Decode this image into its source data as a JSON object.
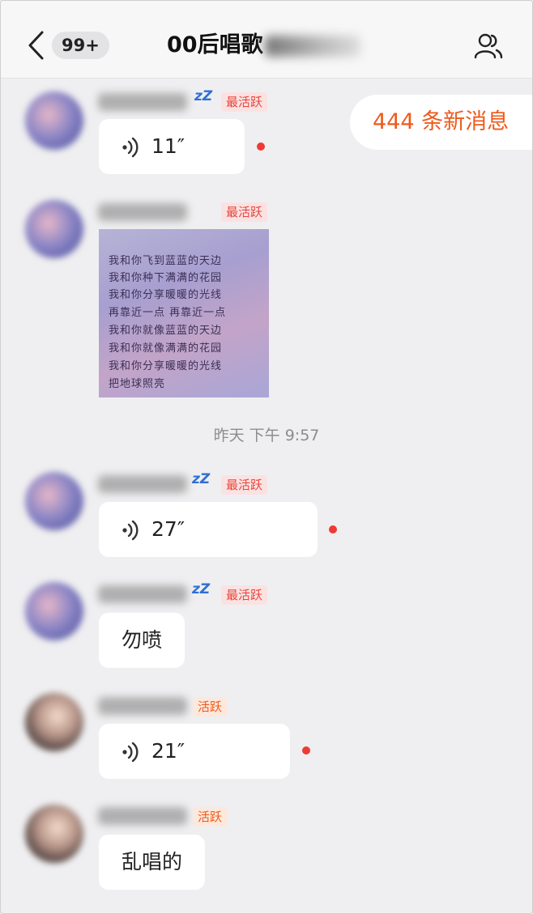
{
  "header": {
    "unread_count": "99+",
    "title": "00后唱歌"
  },
  "icons": {
    "back": "chevron-left-icon",
    "members": "group-members-icon",
    "voice": "voice-wave-icon",
    "sleep": "zzz-icon"
  },
  "new_messages": "444 条新消息",
  "timestamp": "昨天 下午 9:57",
  "colors": {
    "accent": "#ee5a1b",
    "badge_red": "#e8453c",
    "unread_dot": "#ee3a33",
    "sleep_blue": "#2f6fd6"
  },
  "messages": [
    {
      "badge": "最活跃",
      "sleep": "zZ",
      "voice_duration": "11″"
    },
    {
      "badge": "最活跃",
      "image_text": [
        "我和你飞到蓝蓝的天边",
        "我和你种下满满的花园",
        "我和你分享暖暖的光线",
        "再靠近一点 再靠近一点",
        "我和你就像蓝蓝的天边",
        "我和你就像满满的花园",
        "我和你分享暖暖的光线",
        "把地球照亮"
      ]
    },
    {
      "badge": "最活跃",
      "sleep": "zZ",
      "voice_duration": "27″"
    },
    {
      "badge": "最活跃",
      "sleep": "zZ",
      "text": "勿喷"
    },
    {
      "badge": "活跃",
      "voice_duration": "21″"
    },
    {
      "badge": "活跃",
      "text": "乱唱的"
    }
  ]
}
